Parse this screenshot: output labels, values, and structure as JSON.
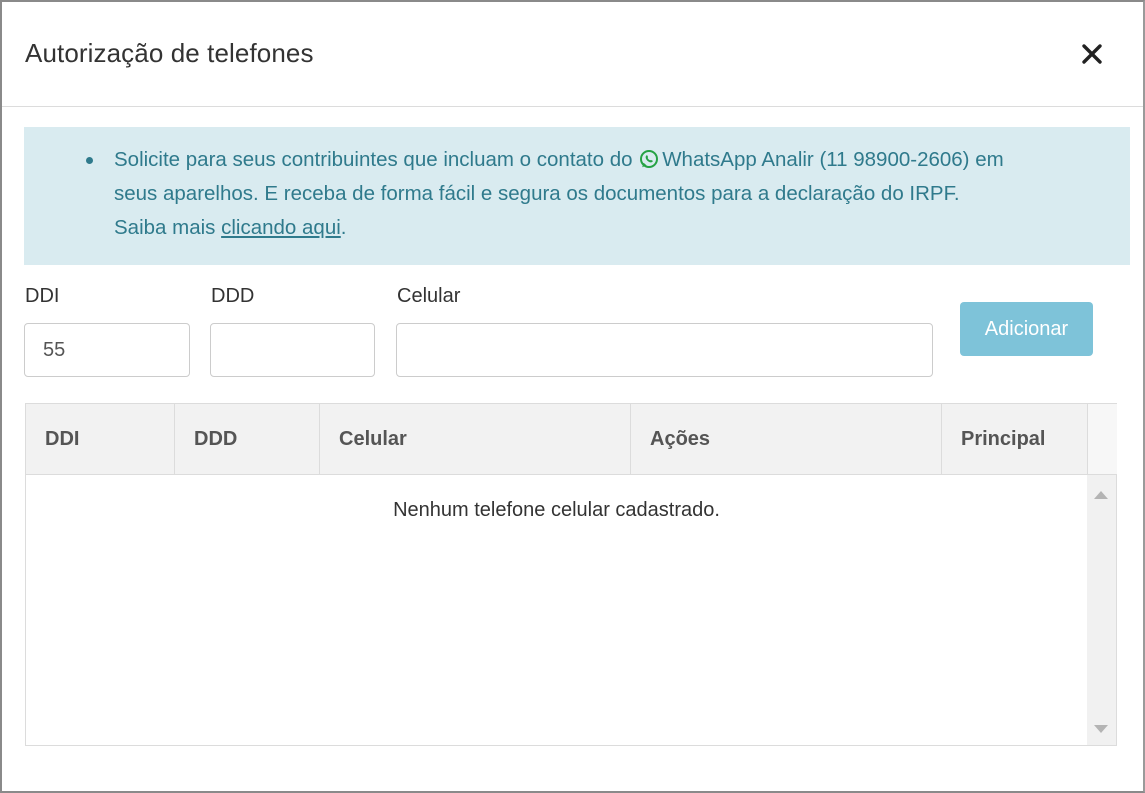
{
  "modal": {
    "title": "Autorização de telefones",
    "close_icon": "close-icon"
  },
  "alert": {
    "text_before_icon": "Solicite para seus contribuintes que incluam o contato do ",
    "icon": "whatsapp-icon",
    "text_after_icon": "WhatsApp Analir (11 98900-2606) em",
    "line2": "seus aparelhos. E receba de forma fácil e segura os documentos para a declaração do IRPF.",
    "line3_prefix": "Saiba mais ",
    "link": "clicando aqui",
    "line3_suffix": "."
  },
  "form": {
    "ddi_label": "DDI",
    "ddi_value": "55",
    "ddd_label": "DDD",
    "ddd_value": "",
    "celular_label": "Celular",
    "celular_value": "",
    "add_button": "Adicionar"
  },
  "grid": {
    "columns": [
      "DDI",
      "DDD",
      "Celular",
      "Ações",
      "Principal"
    ],
    "empty_message": "Nenhum telefone celular cadastrado."
  },
  "colors": {
    "alert_bg": "#d9ebf0",
    "alert_text": "#2f7a8c",
    "button_bg": "#7ec3d9",
    "whatsapp": "#25a244"
  }
}
